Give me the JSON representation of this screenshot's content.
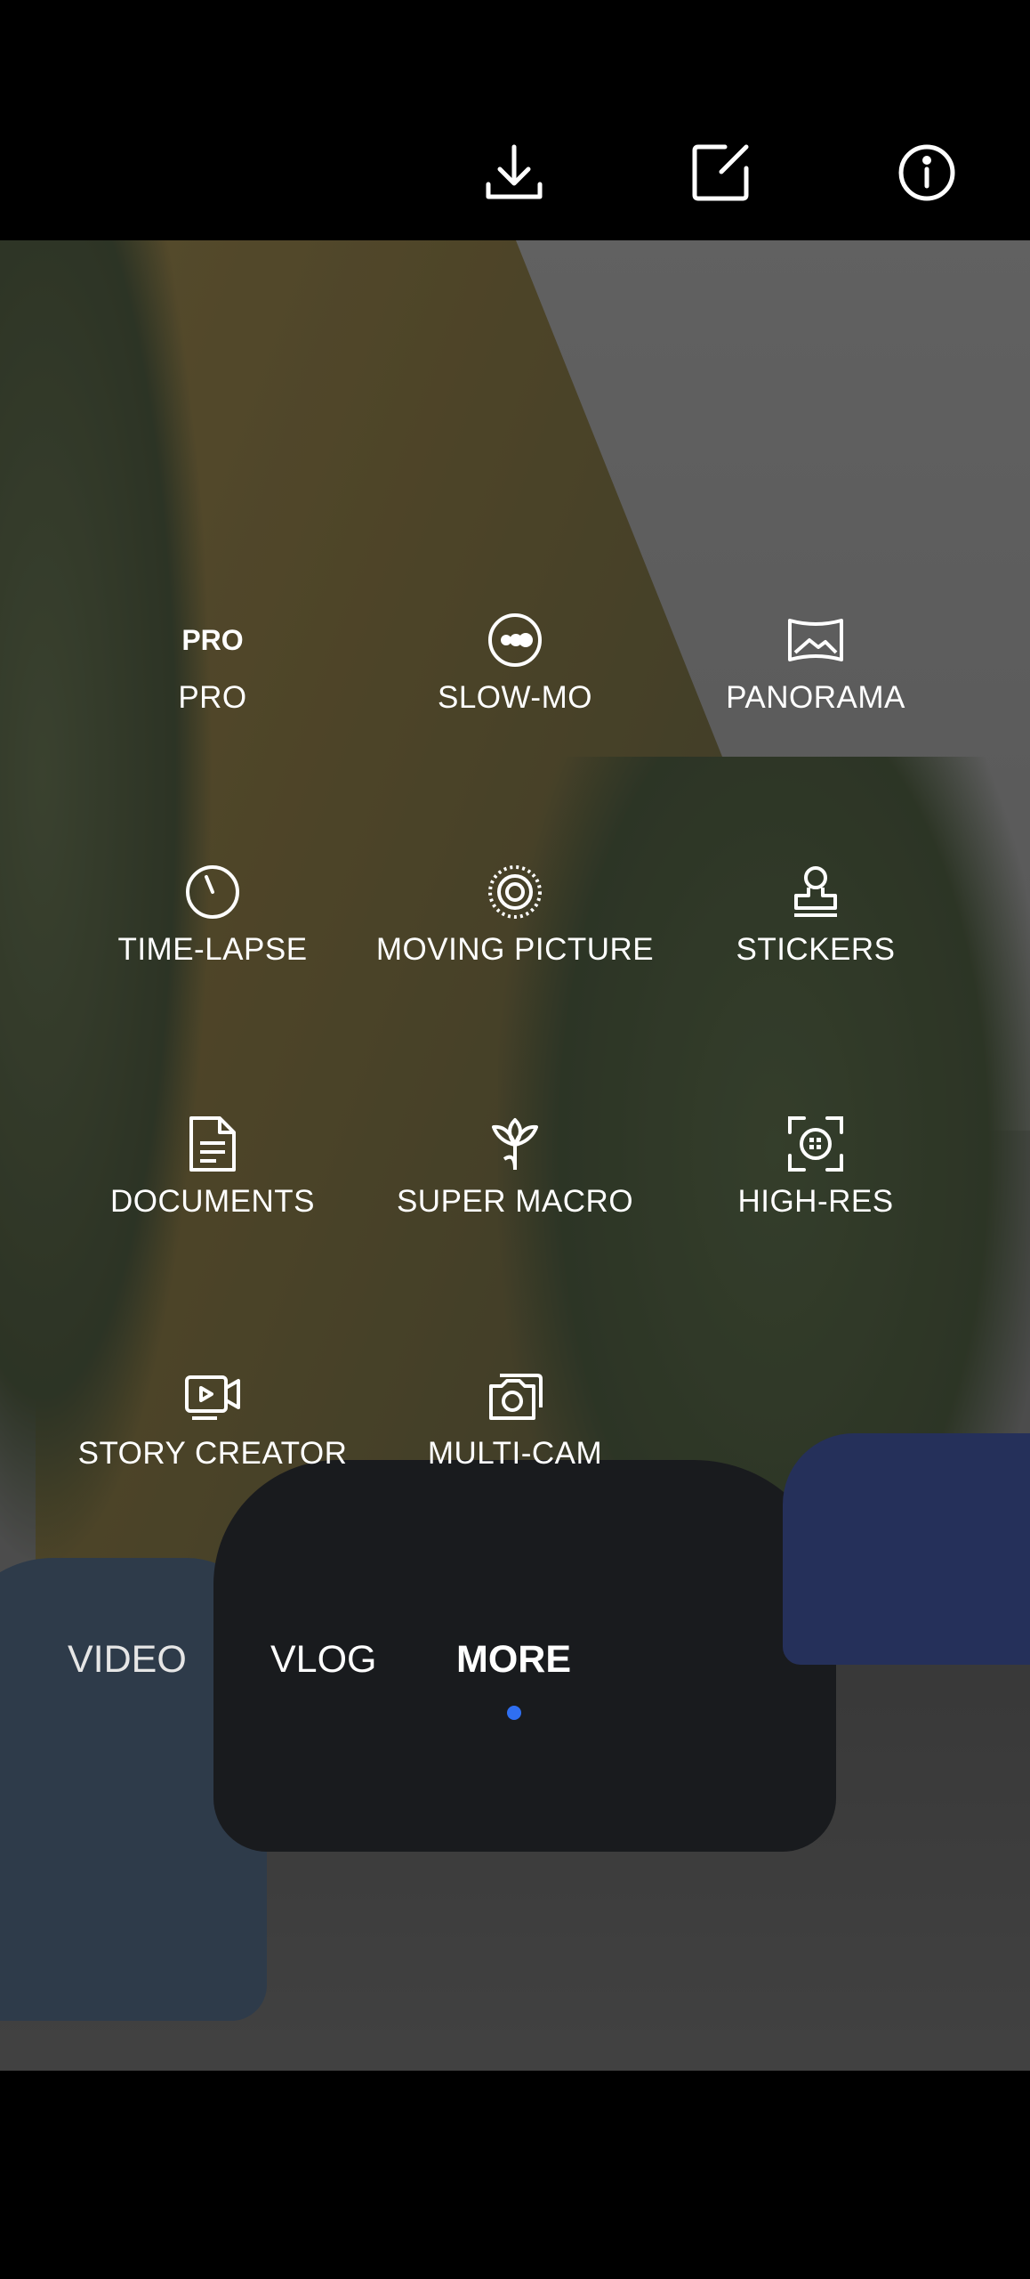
{
  "toolbar": {
    "icons": [
      "download-icon",
      "edit-icon",
      "info-icon"
    ]
  },
  "modes": [
    {
      "label": "PRO",
      "icon": "PRO",
      "icon_name": "pro-icon"
    },
    {
      "label": "SLOW-MO",
      "icon_name": "slow-mo-icon"
    },
    {
      "label": "PANORAMA",
      "icon_name": "panorama-icon"
    },
    {
      "label": "TIME-LAPSE",
      "icon_name": "time-lapse-icon"
    },
    {
      "label": "MOVING PICTURE",
      "icon_name": "moving-picture-icon"
    },
    {
      "label": "STICKERS",
      "icon_name": "stickers-icon"
    },
    {
      "label": "DOCUMENTS",
      "icon_name": "documents-icon"
    },
    {
      "label": "SUPER MACRO",
      "icon_name": "super-macro-icon"
    },
    {
      "label": "HIGH-RES",
      "icon_name": "high-res-icon"
    },
    {
      "label": "STORY CREATOR",
      "icon_name": "story-creator-icon"
    },
    {
      "label": "MULTI-CAM",
      "icon_name": "multi-cam-icon"
    }
  ],
  "tabs": [
    {
      "label": "VIDEO",
      "selected": false
    },
    {
      "label": "VLOG",
      "selected": false
    },
    {
      "label": "MORE",
      "selected": true
    }
  ],
  "colors": {
    "accent": "#2f6ff2",
    "bar_background": "#000000",
    "text": "#ffffff"
  }
}
